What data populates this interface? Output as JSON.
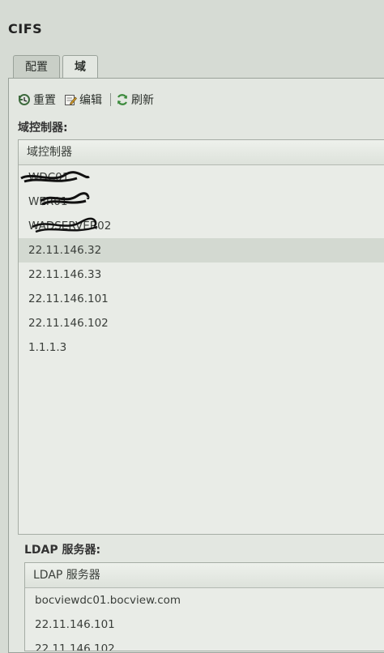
{
  "window": {
    "title": "CIFS"
  },
  "tabs": [
    {
      "label": "配置",
      "active": false
    },
    {
      "label": "域",
      "active": true
    }
  ],
  "toolbar": {
    "reset_label": "重置",
    "edit_label": "编辑",
    "refresh_label": "刷新"
  },
  "domain_controllers": {
    "section_label": "域控制器:",
    "column_header": "域控制器",
    "rows": [
      "WDC01",
      "WER01",
      "WADSERVER02",
      "22.11.146.32",
      "22.11.146.33",
      "22.11.146.101",
      "22.11.146.102",
      "1.1.1.3"
    ]
  },
  "ldap_servers": {
    "section_label": "LDAP 服务器:",
    "column_header": "LDAP 服务器",
    "rows": [
      "bocviewdc01.bocview.com",
      "22.11.146.101",
      "22.11.146.102"
    ]
  },
  "colors": {
    "background": "#d6dbd4",
    "panel": "#e3e7e1",
    "selected_row": "#d3d9d1"
  }
}
